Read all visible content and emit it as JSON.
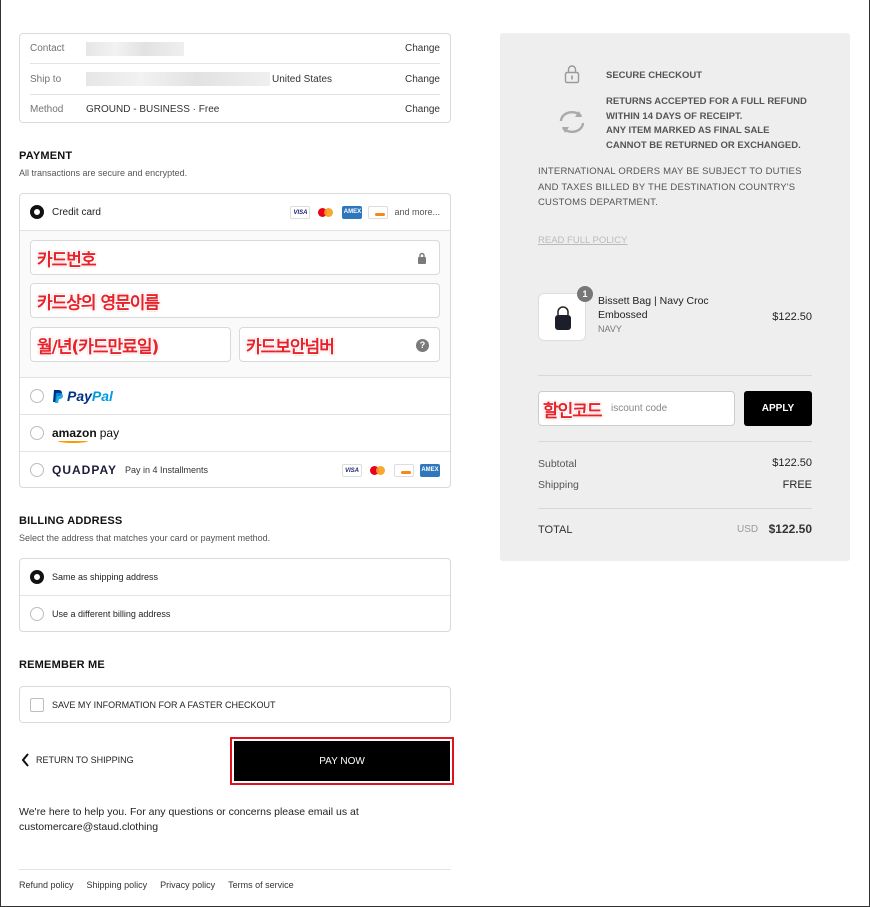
{
  "summary_box": {
    "contact_label": "Contact",
    "ship_to_label": "Ship to",
    "ship_to_country": "United States",
    "method_label": "Method",
    "method_value": "GROUND - BUSINESS · Free",
    "change_label": "Change"
  },
  "payment": {
    "title": "PAYMENT",
    "subtitle": "All transactions are secure and encrypted.",
    "credit_card_label": "Credit card",
    "and_more": "and more...",
    "card_number_annotation": "카드번호",
    "name_annotation": "카드상의 영문이름",
    "expiry_annotation": "월/년(카드만료일)",
    "cvv_annotation": "카드보안넘버",
    "paypal_pay": "Pay",
    "paypal_pal": "Pal",
    "amazon_pay_brand": "amazon",
    "amazon_pay_suffix": "pay",
    "quadpay_brand": "QUADPAY",
    "quadpay_text": "Pay in 4 Installments"
  },
  "billing": {
    "title": "BILLING ADDRESS",
    "subtitle": "Select the address that matches your card or payment method.",
    "same_label": "Same as shipping address",
    "different_label": "Use a different billing address"
  },
  "remember": {
    "title": "REMEMBER ME",
    "checkbox_label": "SAVE MY INFORMATION FOR A FASTER CHECKOUT"
  },
  "actions": {
    "return_label": "RETURN TO SHIPPING",
    "pay_now_label": "PAY NOW"
  },
  "help": {
    "line1": "We're here to help you. For any questions or concerns please email us at",
    "line2": "customercare@staud.clothing"
  },
  "footer": {
    "links": [
      "Refund policy",
      "Shipping policy",
      "Privacy policy",
      "Terms of service"
    ]
  },
  "sidebar": {
    "secure_checkout": "SECURE CHECKOUT",
    "returns_line1": "RETURNS ACCEPTED FOR A FULL REFUND",
    "returns_line2": "WITHIN 14 DAYS OF RECEIPT.",
    "returns_line3": "ANY ITEM MARKED AS FINAL SALE",
    "returns_line4": "CANNOT BE RETURNED OR EXCHANGED.",
    "intl_line1": "INTERNATIONAL ORDERS MAY BE SUBJECT TO DUTIES",
    "intl_line2": "AND TAXES BILLED BY THE DESTINATION COUNTRY'S",
    "intl_line3": "CUSTOMS DEPARTMENT.",
    "read_policy": "READ FULL POLICY",
    "item_qty": "1",
    "item_name_line1": "Bissett Bag | Navy Croc",
    "item_name_line2": "Embossed",
    "item_variant": "NAVY",
    "item_price": "$122.50",
    "discount_annotation": "할인코드",
    "discount_placeholder": "iscount code",
    "apply_label": "APPLY",
    "subtotal_label": "Subtotal",
    "subtotal_value": "$122.50",
    "shipping_label": "Shipping",
    "shipping_value": "FREE",
    "total_label": "TOTAL",
    "total_currency": "USD",
    "total_value": "$122.50"
  },
  "colors": {
    "annotation_red": "#e8222a",
    "pay_button": "#000000",
    "summary_bg": "#eeeeee",
    "paypal_dark": "#003087",
    "paypal_light": "#009cde"
  }
}
